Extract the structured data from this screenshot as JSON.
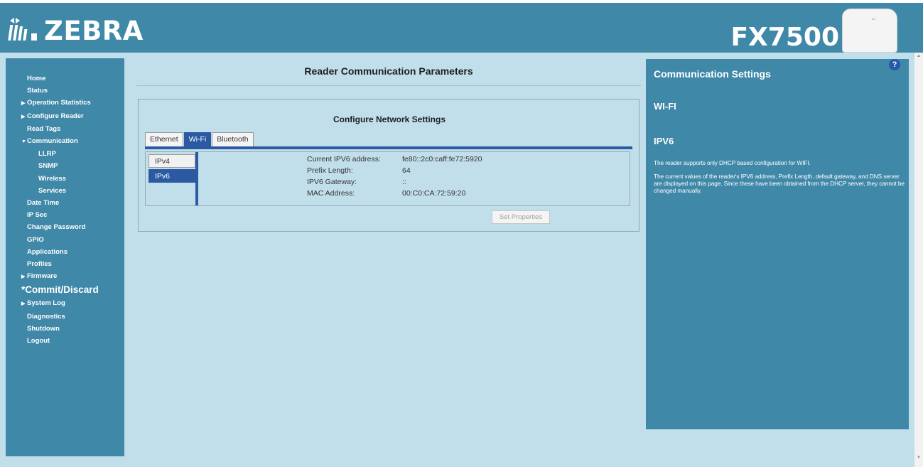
{
  "header": {
    "brand": "ZEBRA",
    "product": "FX7500",
    "device_icon": "rfid-reader-device-icon",
    "device_marking": "'''"
  },
  "nav": {
    "items": [
      {
        "label": "Home",
        "arrow": ""
      },
      {
        "label": "Status",
        "arrow": ""
      },
      {
        "label": "Operation Statistics",
        "arrow": "▶"
      },
      {
        "label": "Configure Reader",
        "arrow": "▶"
      },
      {
        "label": "Read Tags",
        "arrow": ""
      },
      {
        "label": "Communication",
        "arrow": "▼"
      },
      {
        "label": "LLRP",
        "arrow": ""
      },
      {
        "label": "SNMP",
        "arrow": ""
      },
      {
        "label": "Wireless",
        "arrow": ""
      },
      {
        "label": "Services",
        "arrow": ""
      },
      {
        "label": "Date Time",
        "arrow": ""
      },
      {
        "label": "IP Sec",
        "arrow": ""
      },
      {
        "label": "Change Password",
        "arrow": ""
      },
      {
        "label": "GPIO",
        "arrow": ""
      },
      {
        "label": "Applications",
        "arrow": ""
      },
      {
        "label": "Profiles",
        "arrow": ""
      },
      {
        "label": "Firmware",
        "arrow": "▶"
      },
      {
        "label": "*Commit/Discard",
        "arrow": ""
      },
      {
        "label": "System Log",
        "arrow": "▶"
      },
      {
        "label": "Diagnostics",
        "arrow": ""
      },
      {
        "label": "Shutdown",
        "arrow": ""
      },
      {
        "label": "Logout",
        "arrow": ""
      }
    ]
  },
  "main": {
    "title": "Reader Communication Parameters",
    "section_title": "Configure Network Settings",
    "tabs": [
      {
        "label": "Ethernet",
        "active": false
      },
      {
        "label": "Wi-Fi",
        "active": true
      },
      {
        "label": "Bluetooth",
        "active": false
      }
    ],
    "subtabs": [
      {
        "label": "IPv4",
        "active": false
      },
      {
        "label": "IPv6",
        "active": true
      }
    ],
    "fields": [
      {
        "label": "Current IPV6 address:",
        "value": "fe80::2c0:caff:fe72:5920"
      },
      {
        "label": "Prefix Length:",
        "value": "64"
      },
      {
        "label": "IPV6 Gateway:",
        "value": "::"
      },
      {
        "label": "MAC Address:",
        "value": "00:C0:CA:72:59:20"
      }
    ],
    "set_properties_label": "Set Properties"
  },
  "help": {
    "icon_label": "?",
    "title": "Communication Settings",
    "section1": "WI-FI",
    "section2": "IPV6",
    "para1": "The reader supports only DHCP based configuration for WIFI.",
    "para2": "The current values of the reader's IPV6 address, Prefix Length, default gateway, and DNS server are displayed on this page. Since these have been obtained from the DHCP server, they cannot be changed manually."
  },
  "colors": {
    "brand_teal": "#3f88a8",
    "page_bg": "#c1deeb",
    "active_tab": "#2b5aa3"
  }
}
